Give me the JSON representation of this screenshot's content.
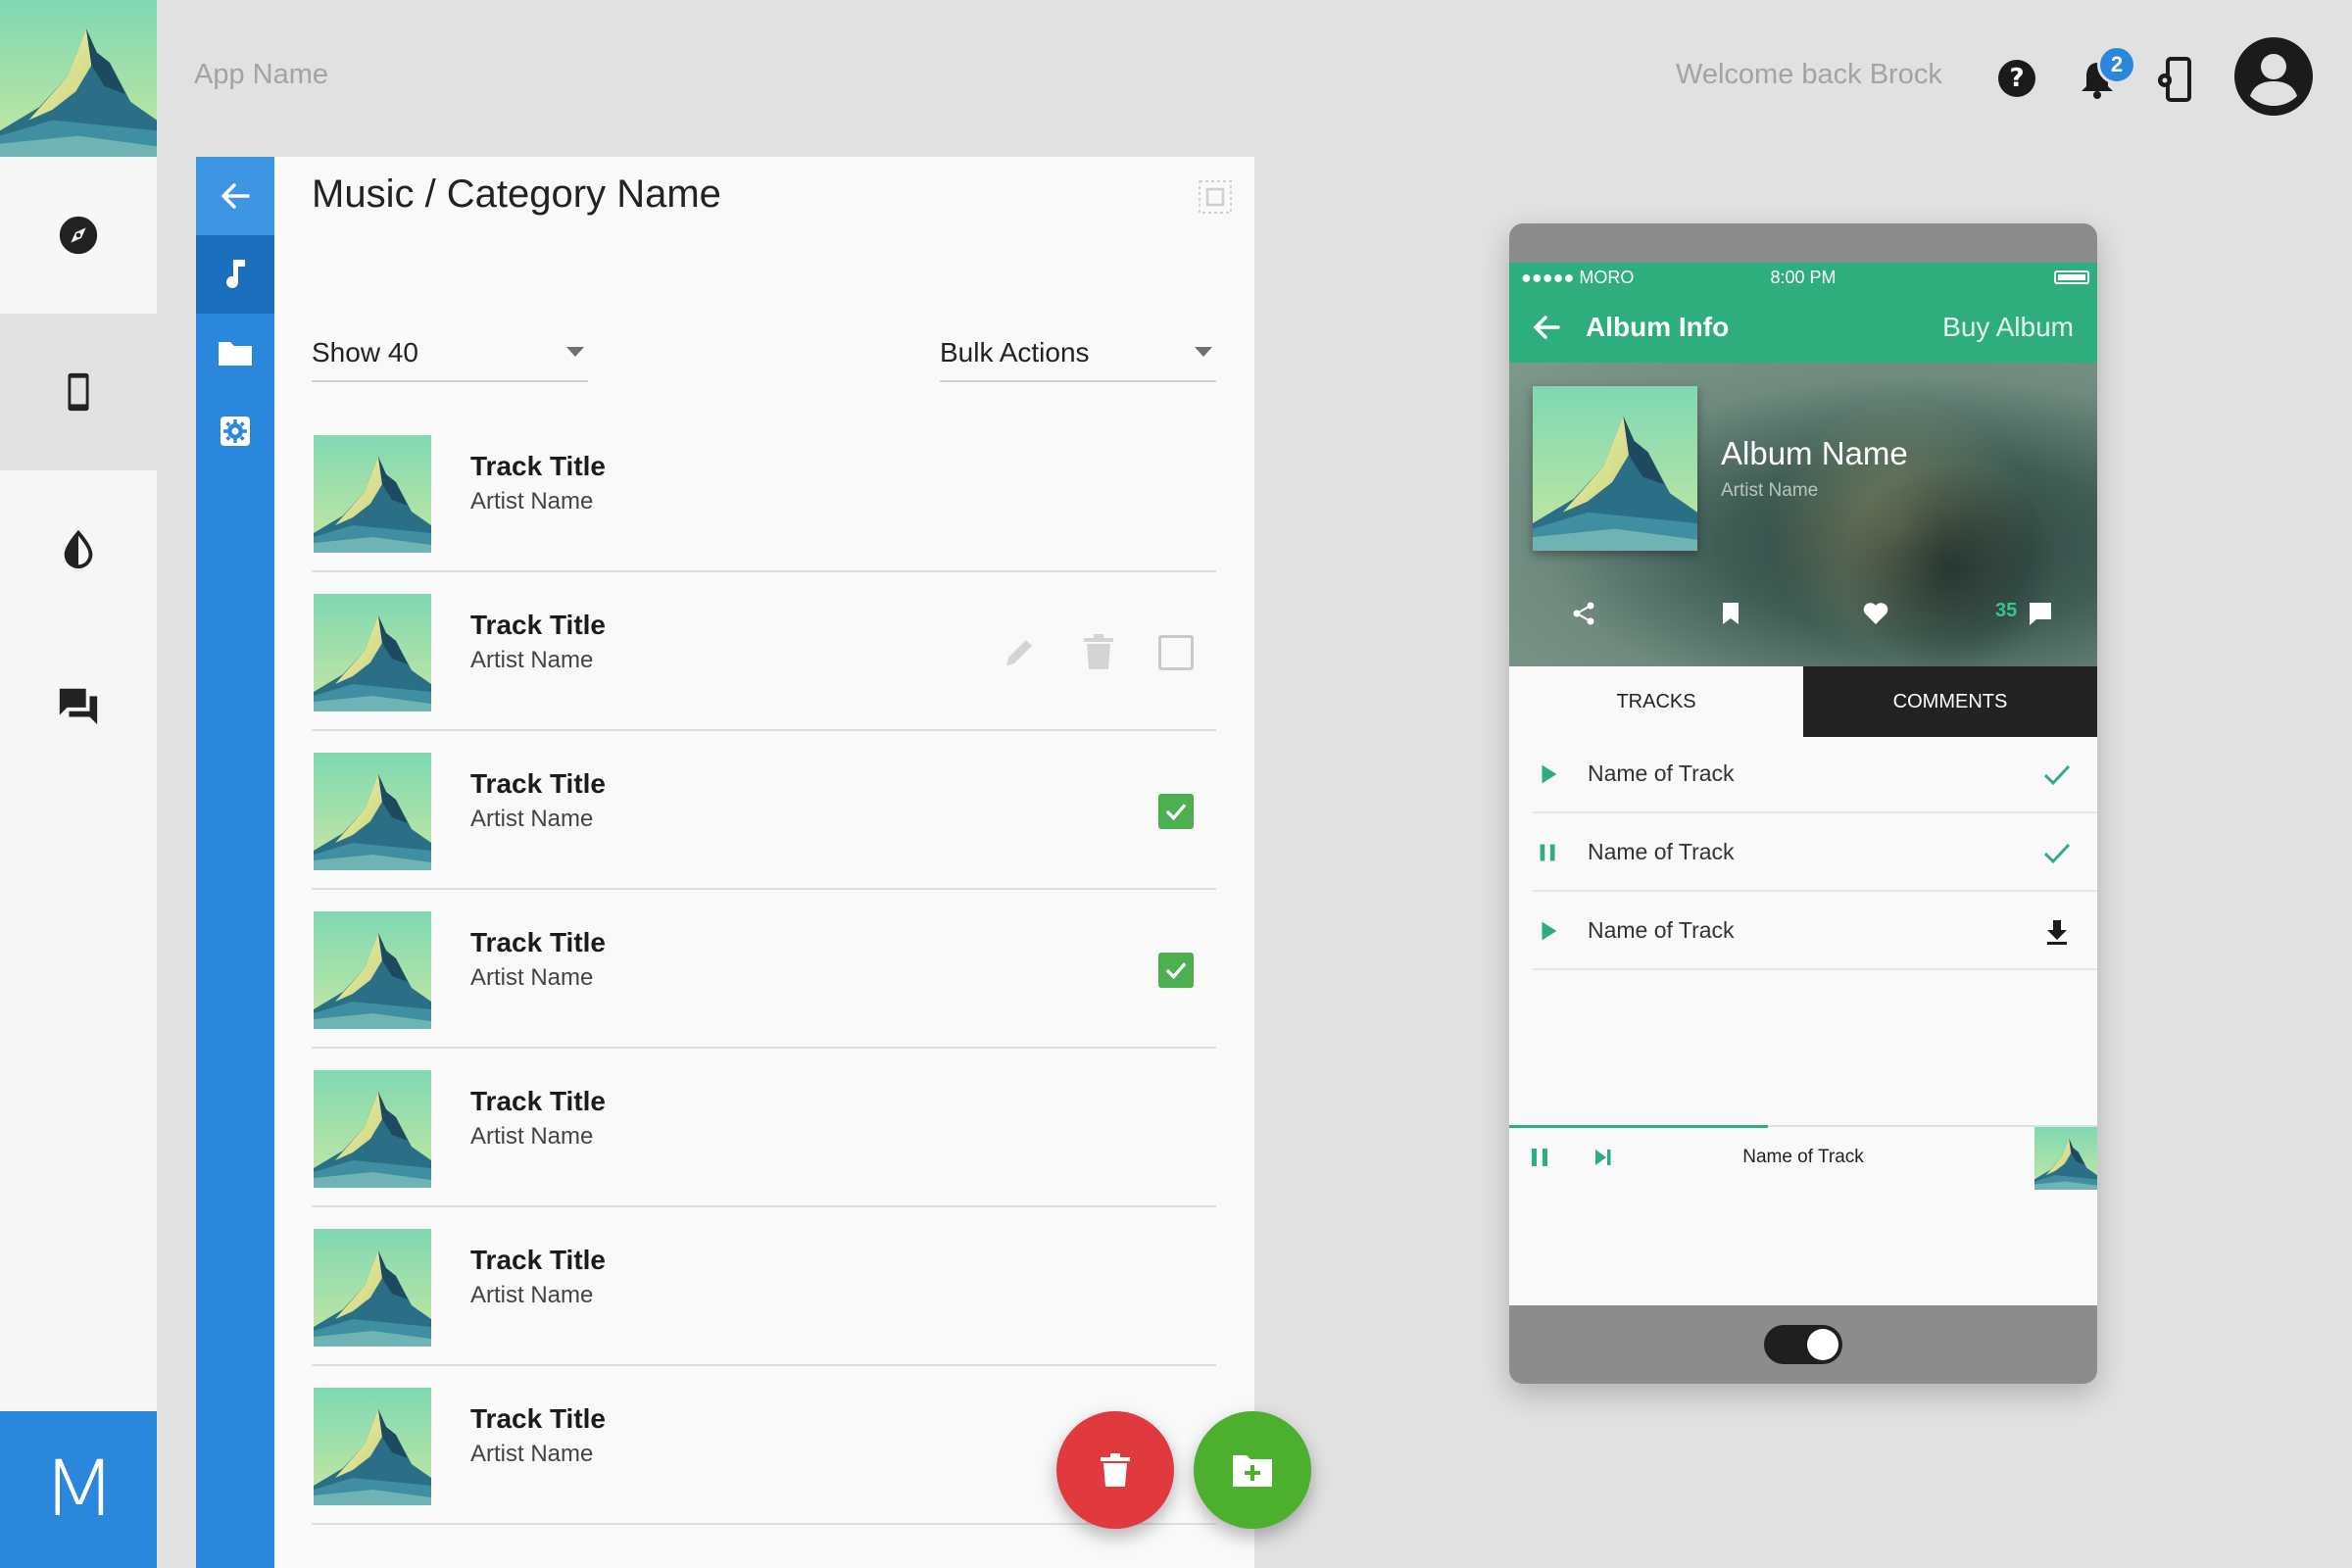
{
  "app": {
    "name": "App Name",
    "welcome": "Welcome back Brock",
    "notification_count": "2",
    "brand_letter": "M"
  },
  "nav": [
    {
      "icon": "compass-icon",
      "label": "Explore"
    },
    {
      "icon": "phone-icon",
      "label": "Mobile"
    },
    {
      "icon": "droplet-icon",
      "label": "Theme"
    },
    {
      "icon": "chat-icon",
      "label": "Messages"
    }
  ],
  "subnav": [
    {
      "icon": "back-arrow-icon"
    },
    {
      "icon": "music-note-icon"
    },
    {
      "icon": "folder-icon"
    },
    {
      "icon": "settings-icon"
    }
  ],
  "page": {
    "title": "Music / Category Name",
    "show_select": "Show 40",
    "bulk_select": "Bulk Actions"
  },
  "tracks": [
    {
      "title": "Track Title",
      "artist": "Artist Name",
      "checked": false,
      "actions": false
    },
    {
      "title": "Track Title",
      "artist": "Artist Name",
      "checked": false,
      "actions": true
    },
    {
      "title": "Track Title",
      "artist": "Artist Name",
      "checked": true,
      "actions": false
    },
    {
      "title": "Track Title",
      "artist": "Artist Name",
      "checked": true,
      "actions": false
    },
    {
      "title": "Track Title",
      "artist": "Artist Name",
      "checked": false,
      "actions": false
    },
    {
      "title": "Track Title",
      "artist": "Artist Name",
      "checked": false,
      "actions": false
    },
    {
      "title": "Track Title",
      "artist": "Artist Name",
      "checked": false,
      "actions": false
    }
  ],
  "phone": {
    "carrier": "●●●●● MORO",
    "time": "8:00 PM",
    "appbar_title": "Album Info",
    "buy_label": "Buy Album",
    "album_name": "Album Name",
    "album_artist": "Artist Name",
    "comment_count": "35",
    "tabs": [
      "TRACKS",
      "COMMENTS"
    ],
    "tracks": [
      {
        "name": "Name of Track",
        "state": "play",
        "end": "check"
      },
      {
        "name": "Name of Track",
        "state": "pause",
        "end": "check"
      },
      {
        "name": "Name of Track",
        "state": "play",
        "end": "download"
      }
    ],
    "player": {
      "track": "Name of Track",
      "progress": 0.44
    }
  },
  "colors": {
    "blue": "#2b87dc",
    "green": "#2fae7d",
    "check_green": "#4caf50",
    "red": "#e0393e"
  }
}
